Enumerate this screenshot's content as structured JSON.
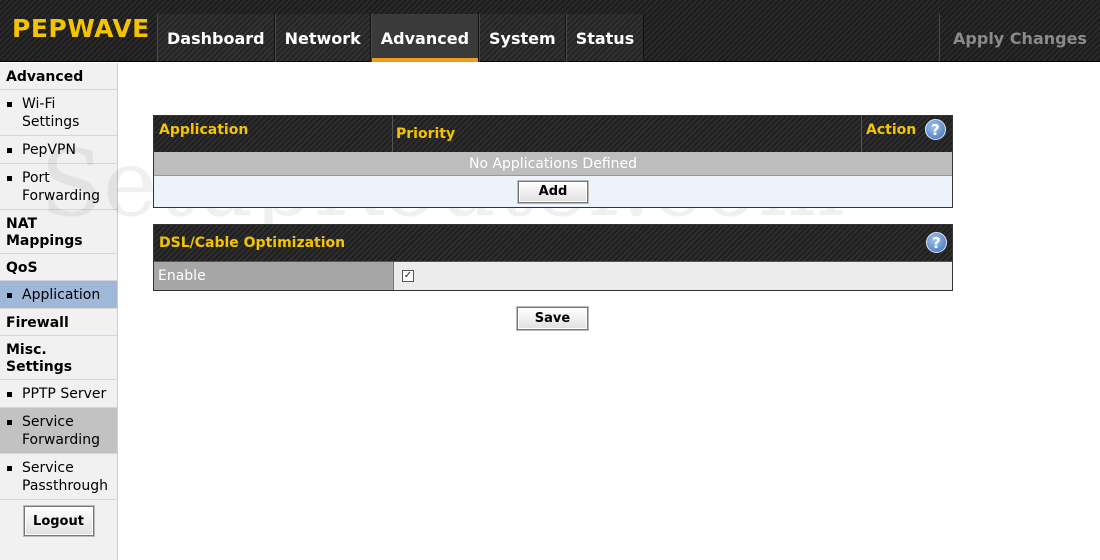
{
  "header": {
    "logo": "PEPWAVE",
    "tabs": [
      {
        "label": "Dashboard"
      },
      {
        "label": "Network"
      },
      {
        "label": "Advanced"
      },
      {
        "label": "System"
      },
      {
        "label": "Status"
      }
    ],
    "active_tab": "Advanced",
    "apply_label": "Apply Changes"
  },
  "sidebar": {
    "sections": [
      {
        "title": "Advanced",
        "items": [
          "Wi-Fi Settings",
          "PepVPN",
          "Port Forwarding"
        ]
      },
      {
        "title": "NAT Mappings",
        "items": []
      },
      {
        "title": "QoS",
        "items": [
          "Application"
        ]
      },
      {
        "title": "Firewall",
        "items": []
      },
      {
        "title": "Misc. Settings",
        "items": [
          "PPTP Server",
          "Service Forwarding",
          "Service Passthrough"
        ]
      }
    ],
    "active_item": "Application",
    "hover_item": "Service Forwarding",
    "logout_label": "Logout"
  },
  "watermark": "SetupRouter.com",
  "app_table": {
    "col_application": "Application",
    "col_priority": "Priority",
    "col_action": "Action",
    "empty_text": "No Applications Defined",
    "add_label": "Add"
  },
  "dsl_table": {
    "title": "DSL/Cable Optimization",
    "enable_label": "Enable",
    "enable_checked": true
  },
  "save_label": "Save",
  "colors": {
    "accent": "#f4c400",
    "active_tab_underline": "#f29b1d",
    "sidebar_active": "#9fb8d8"
  }
}
